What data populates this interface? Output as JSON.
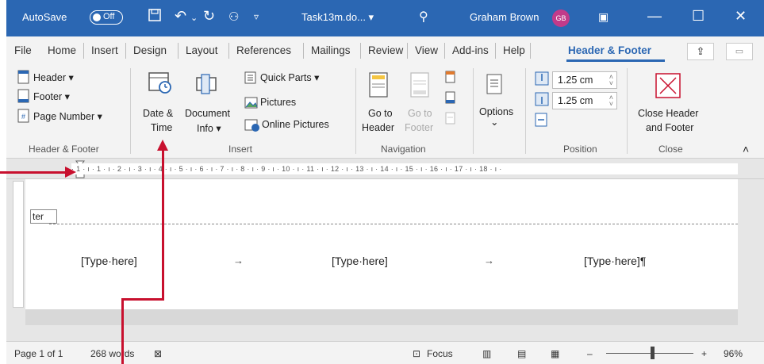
{
  "title_bar": {
    "autosave_label": "AutoSave",
    "autosave_state": "Off",
    "filename": "Task13m.do... ▾",
    "user_name": "Graham Brown",
    "user_initials": "GB"
  },
  "tabs": [
    "File",
    "Home",
    "Insert",
    "Design",
    "Layout",
    "References",
    "Mailings",
    "Review",
    "View",
    "Add-ins",
    "Help",
    "Header & Footer"
  ],
  "active_tab": "Header & Footer",
  "ribbon": {
    "header_footer_group": {
      "header": "Header ▾",
      "footer": "Footer ▾",
      "page_number": "Page Number ▾",
      "label": "Header & Footer"
    },
    "insert_group": {
      "date_time_line1": "Date &",
      "date_time_line2": "Time",
      "doc_info_line1": "Document",
      "doc_info_line2": "Info ▾",
      "quick_parts": "Quick Parts ▾",
      "pictures": "Pictures",
      "online_pictures": "Online Pictures",
      "label": "Insert"
    },
    "navigation_group": {
      "goto_header_line1": "Go to",
      "goto_header_line2": "Header",
      "goto_footer_line1": "Go to",
      "goto_footer_line2": "Footer",
      "label": "Navigation"
    },
    "options_group": {
      "options": "Options",
      "chevron": "⌄"
    },
    "position_group": {
      "header_from_top": "1.25 cm",
      "footer_from_bottom": "1.25 cm",
      "label": "Position"
    },
    "close_group": {
      "close_line1": "Close Header",
      "close_line2": "and Footer",
      "label": "Close"
    }
  },
  "ruler": {
    "marks": "· 1 · ı · 1 · ı · 2 · ı · 3 · ı · 4 · ı · 5 · ı · 6 · ı · 7 · ı · 8 · ı · 9 · ı · 10 · ı · 11 · ı · 12 · ı · 13 · ı · 14 · ı · 15 · ı · 16 · ı · 17 · ı · 18 · ı ·"
  },
  "document": {
    "footer_tag": "ter",
    "left_cell": "[Type·here]",
    "center_cell": "[Type·here]",
    "right_cell": "[Type·here]¶",
    "tab_arrow": "→"
  },
  "status_bar": {
    "page": "Page 1 of 1",
    "words": "268 words",
    "focus": "Focus",
    "zoom_minus": "–",
    "zoom_plus": "+",
    "zoom": "96%",
    "zoom_level": 0.5
  },
  "colors": {
    "accent": "#2b67b3",
    "callout": "#c8102e"
  }
}
